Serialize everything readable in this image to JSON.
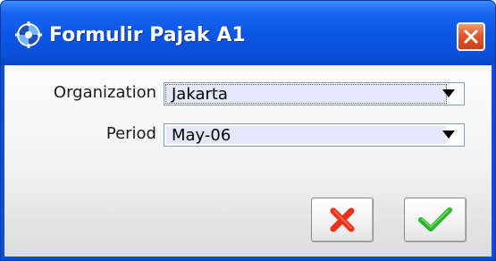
{
  "window": {
    "title": "Formulir Pajak A1",
    "icon": "gear-globe-icon",
    "close_icon": "close-icon",
    "title_color": "#0a4fd6"
  },
  "form": {
    "organization": {
      "label": "Organization",
      "value": "Jakarta"
    },
    "period": {
      "label": "Period",
      "value": "May-06"
    }
  },
  "buttons": {
    "cancel_icon": "red-x-icon",
    "ok_icon": "green-check-icon"
  },
  "colors": {
    "field_bg": "#e6e7fb",
    "cancel": "#e8321c",
    "ok": "#2fb52b"
  }
}
